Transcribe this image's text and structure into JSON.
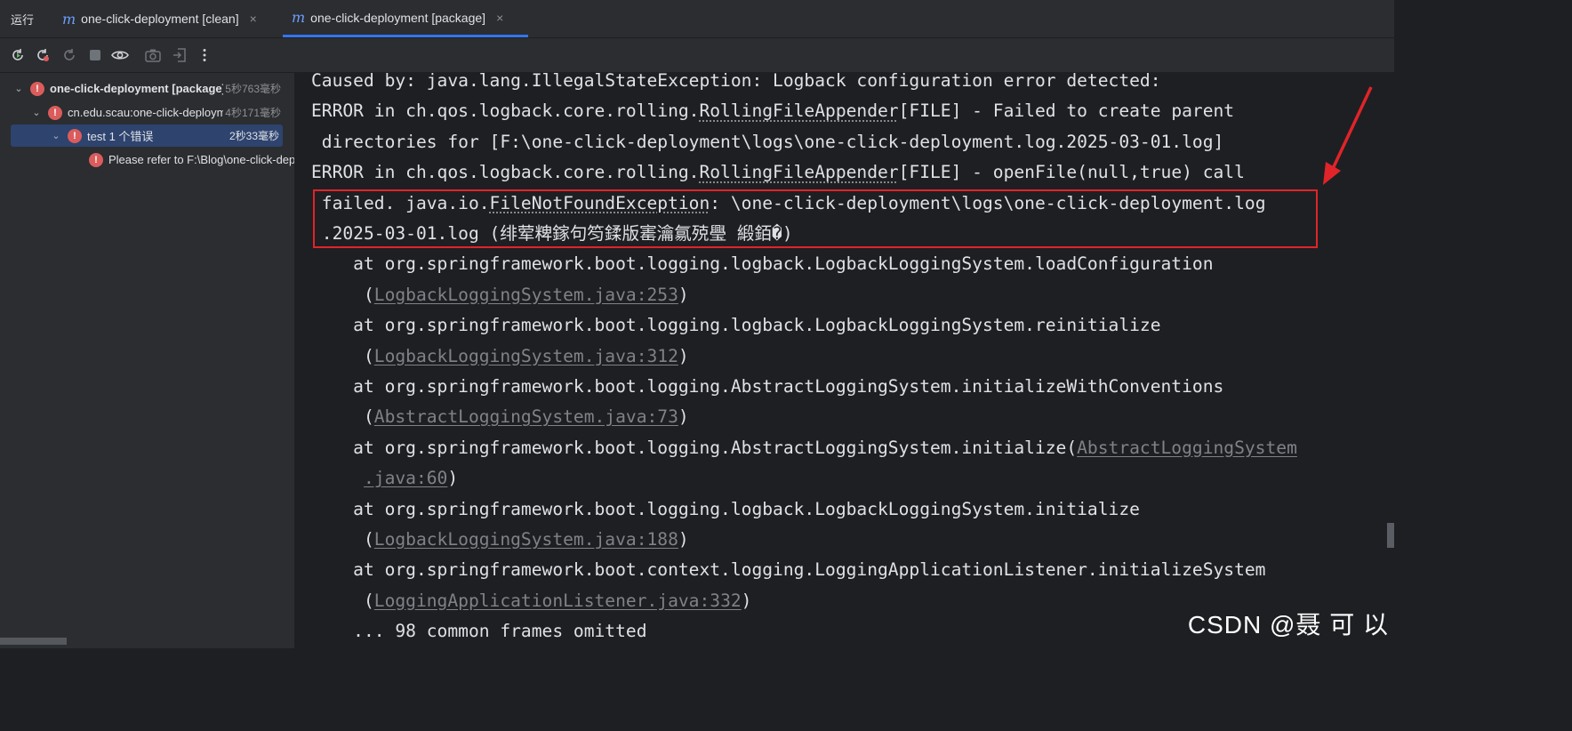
{
  "tabbar": {
    "run_label": "运行",
    "tabs": [
      {
        "icon": "maven-m-icon",
        "label": "one-click-deployment [clean]"
      },
      {
        "icon": "maven-m-icon",
        "label": "one-click-deployment [package]"
      }
    ],
    "close_glyph": "×",
    "m_glyph": "m"
  },
  "toolbar": {
    "icons": [
      "rerun-icon",
      "rerun-failed-icon",
      "rerun-dependent-icon",
      "stop-icon",
      "eye-icon",
      "camera-icon",
      "exit-icon",
      "more-icon"
    ]
  },
  "tree": {
    "rows": [
      {
        "label": "one-click-deployment [package]",
        "time": "5秒763毫秒",
        "status": "error"
      },
      {
        "label": "cn.edu.scau:one-click-deployment",
        "time": "4秒171毫秒",
        "status": "error"
      },
      {
        "label": "test  1 个错误",
        "time": "2秒33毫秒",
        "status": "error"
      },
      {
        "label": "Please refer to F:\\Blog\\one-click-deployment",
        "time": "",
        "status": "error"
      }
    ]
  },
  "console": {
    "lines": [
      {
        "text": "Caused by: java.lang.IllegalStateException: Logback configuration error detected:"
      },
      {
        "pre": "ERROR in ch.qos.logback.core.rolling.",
        "link": "RollingFileAppender",
        "post": "[FILE] - Failed to create parent"
      },
      {
        "text": " directories for [F:\\one-click-deployment\\logs\\one-click-deployment.log.2025-03-01.log]"
      },
      {
        "pre": "ERROR in ch.qos.logback.core.rolling.",
        "link": "RollingFileAppender",
        "post": "[FILE] - openFile(null,true) call"
      },
      {
        "pre": " failed. java.io.",
        "link": "FileNotFoundException",
        "post": ": \\one-click-deployment\\logs\\one-click-deployment.log"
      },
      {
        "text": " .2025-03-01.log (绯荤粺鎵句笉鍒版寚瀹氱殑璺 緞銆�)"
      },
      {
        "text": "    at org.springframework.boot.logging.logback.LogbackLoggingSystem.loadConfiguration"
      },
      {
        "pre": "     (",
        "file": "LogbackLoggingSystem.java:253",
        "post": ")"
      },
      {
        "text": "    at org.springframework.boot.logging.logback.LogbackLoggingSystem.reinitialize"
      },
      {
        "pre": "     (",
        "file": "LogbackLoggingSystem.java:312",
        "post": ")"
      },
      {
        "text": "    at org.springframework.boot.logging.AbstractLoggingSystem.initializeWithConventions"
      },
      {
        "pre": "     (",
        "file": "AbstractLoggingSystem.java:73",
        "post": ")"
      },
      {
        "pre": "    at org.springframework.boot.logging.AbstractLoggingSystem.initialize(",
        "file": "AbstractLoggingSystem",
        "post": ""
      },
      {
        "pre": "     ",
        "file": ".java:60",
        "post": ")"
      },
      {
        "text": "    at org.springframework.boot.logging.logback.LogbackLoggingSystem.initialize"
      },
      {
        "pre": "     (",
        "file": "LogbackLoggingSystem.java:188",
        "post": ")"
      },
      {
        "text": "    at org.springframework.boot.context.logging.LoggingApplicationListener.initializeSystem"
      },
      {
        "pre": "     (",
        "file": "LoggingApplicationListener.java:332",
        "post": ")"
      },
      {
        "text": "    ... 98 common frames omitted"
      }
    ]
  },
  "annotation": {
    "box_color": "#e0242a",
    "arrow_color": "#e0242a"
  },
  "watermark": "CSDN @聂 可 以"
}
